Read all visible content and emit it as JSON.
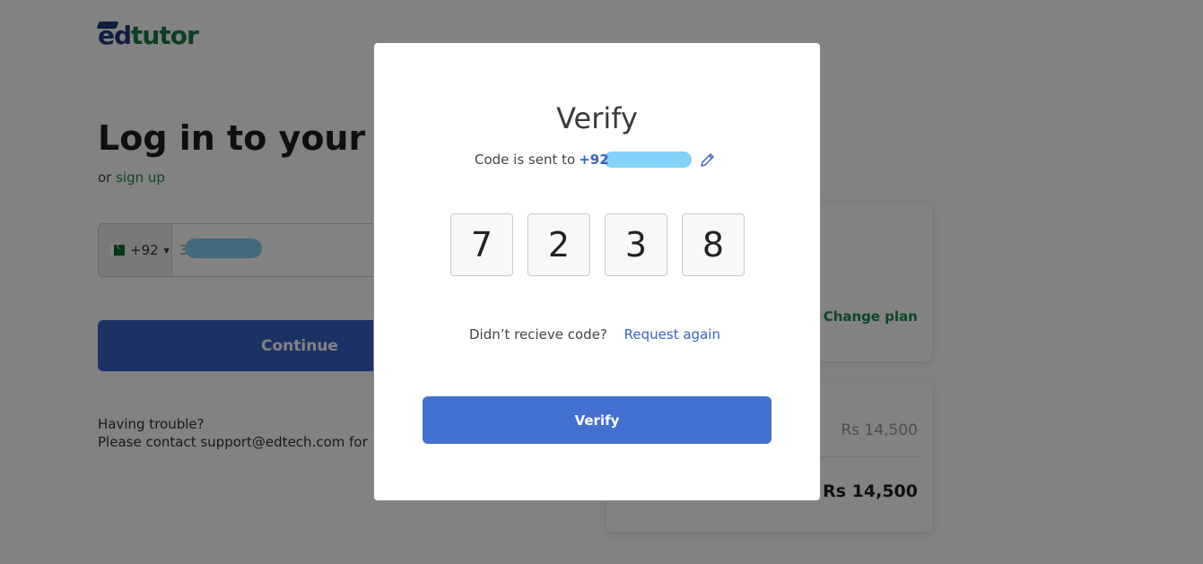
{
  "brand": {
    "part1": "ed",
    "part2": "tutor"
  },
  "login": {
    "title": "Log in to your ac",
    "signup_prefix": "or ",
    "signup_link": "sign up",
    "country_code": "+92",
    "phone_partial": "3",
    "continue_label": "Continue",
    "trouble_line1": "Having trouble?",
    "trouble_line2": "Please contact support@edtech.com for"
  },
  "plan_card": {
    "change_plan": "Change plan"
  },
  "summary_card": {
    "price": "Rs 14,500",
    "total": "Rs 14,500"
  },
  "modal": {
    "title": "Verify",
    "sent_prefix": "Code is sent to",
    "sent_number": "+92",
    "otp_digits": [
      "7",
      "2",
      "3",
      "8"
    ],
    "resend_prompt": "Didn’t recieve code?",
    "resend_link": "Request again",
    "verify_label": "Verify",
    "edit_icon": "pencil-icon"
  },
  "colors": {
    "primary": "#4370d1",
    "brand_green": "#1a8a4a",
    "brand_blue": "#1f3b7a",
    "redaction": "#82d1f6"
  }
}
